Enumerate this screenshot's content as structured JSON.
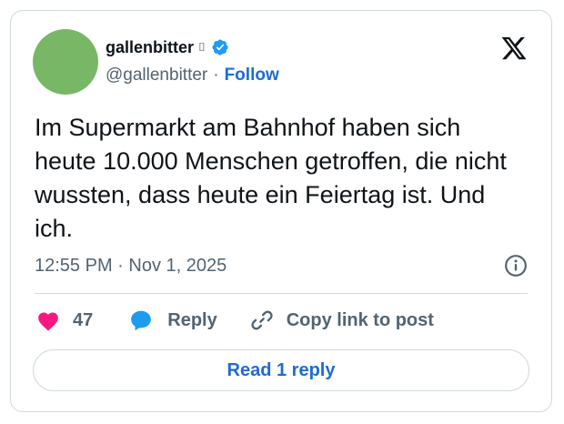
{
  "author": {
    "display_name": "gallenbitter",
    "name_glyph": "⌷",
    "handle": "@gallenbitter",
    "separator": "·",
    "follow_label": "Follow",
    "avatar_color": "#77b765",
    "verified": true
  },
  "tweet": {
    "text": "Im Supermarkt am Bahnhof haben sich heute 10.000 Menschen getroffen, die nicht wussten, dass heute ein Feiertag ist. Und ich.",
    "timestamp": "12:55 PM · Nov 1, 2025"
  },
  "actions": {
    "like_count": "47",
    "reply_label": "Reply",
    "copy_label": "Copy link to post"
  },
  "read_replies_label": "Read 1 reply",
  "icons": {
    "brand": "x-logo-icon",
    "verified": "verified-badge-icon",
    "info": "info-icon",
    "like": "heart-icon",
    "reply": "speech-bubble-icon",
    "copy": "link-icon"
  },
  "colors": {
    "accent_blue": "#1d6bd6",
    "heart": "#f91880",
    "muted_text": "#536471",
    "border": "#cfd9de",
    "verified": "#1d9bf0"
  }
}
